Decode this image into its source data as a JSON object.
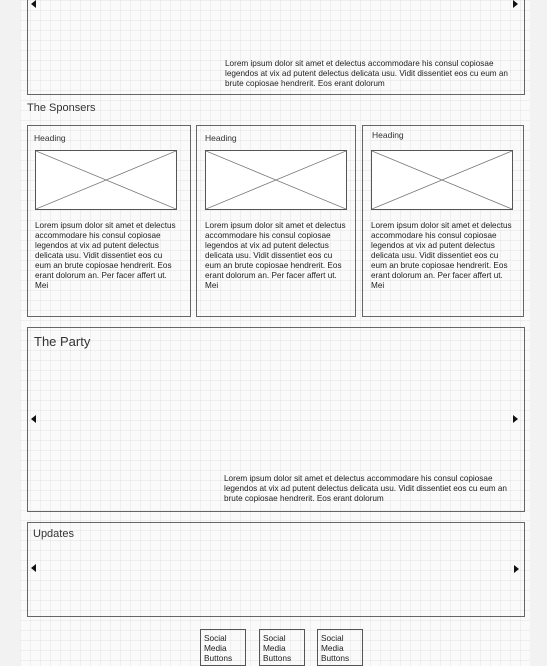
{
  "hero": {
    "caption": "Lorem ipsum dolor sit amet et delectus accommodare his consul copiosae legendos at vix ad putent delectus delicata usu. Vidit dissentiet eos cu eum an brute copiosae hendrerit. Eos erant dolorum"
  },
  "sponsors": {
    "title": "The Sponsers",
    "cards": [
      {
        "heading": "Heading",
        "text": "Lorem ipsum dolor sit amet et delectus accommodare his consul copiosae legendos at vix ad putent delectus delicata usu. Vidit dissentiet eos cu eum an brute copiosae hendrerit. Eos erant dolorum an. Per facer affert ut. Mei"
      },
      {
        "heading": "Heading",
        "text": "Lorem ipsum dolor sit amet et delectus accommodare his consul copiosae legendos at vix ad putent delectus delicata usu. Vidit dissentiet eos cu eum an brute copiosae hendrerit. Eos erant dolorum an. Per facer affert ut. Mei"
      },
      {
        "heading": "Heading",
        "text": "Lorem ipsum dolor sit amet et delectus accommodare his consul copiosae legendos at vix ad putent delectus delicata usu. Vidit dissentiet eos cu eum an brute copiosae hendrerit. Eos erant dolorum an. Per facer affert ut. Mei"
      }
    ]
  },
  "party": {
    "title": "The Party",
    "caption": "Lorem ipsum dolor sit amet et delectus accommodare his consul copiosae legendos at vix ad putent delectus delicata usu. Vidit dissentiet eos cu eum an brute copiosae hendrerit. Eos erant dolorum"
  },
  "updates": {
    "title": "Updates"
  },
  "social": {
    "buttons": [
      "Social Media Buttons",
      "Social Media Buttons",
      "Social Media Buttons"
    ]
  },
  "icons": {
    "prev": "triangle-left-icon",
    "next": "triangle-right-icon",
    "placeholder": "image-placeholder-icon"
  }
}
